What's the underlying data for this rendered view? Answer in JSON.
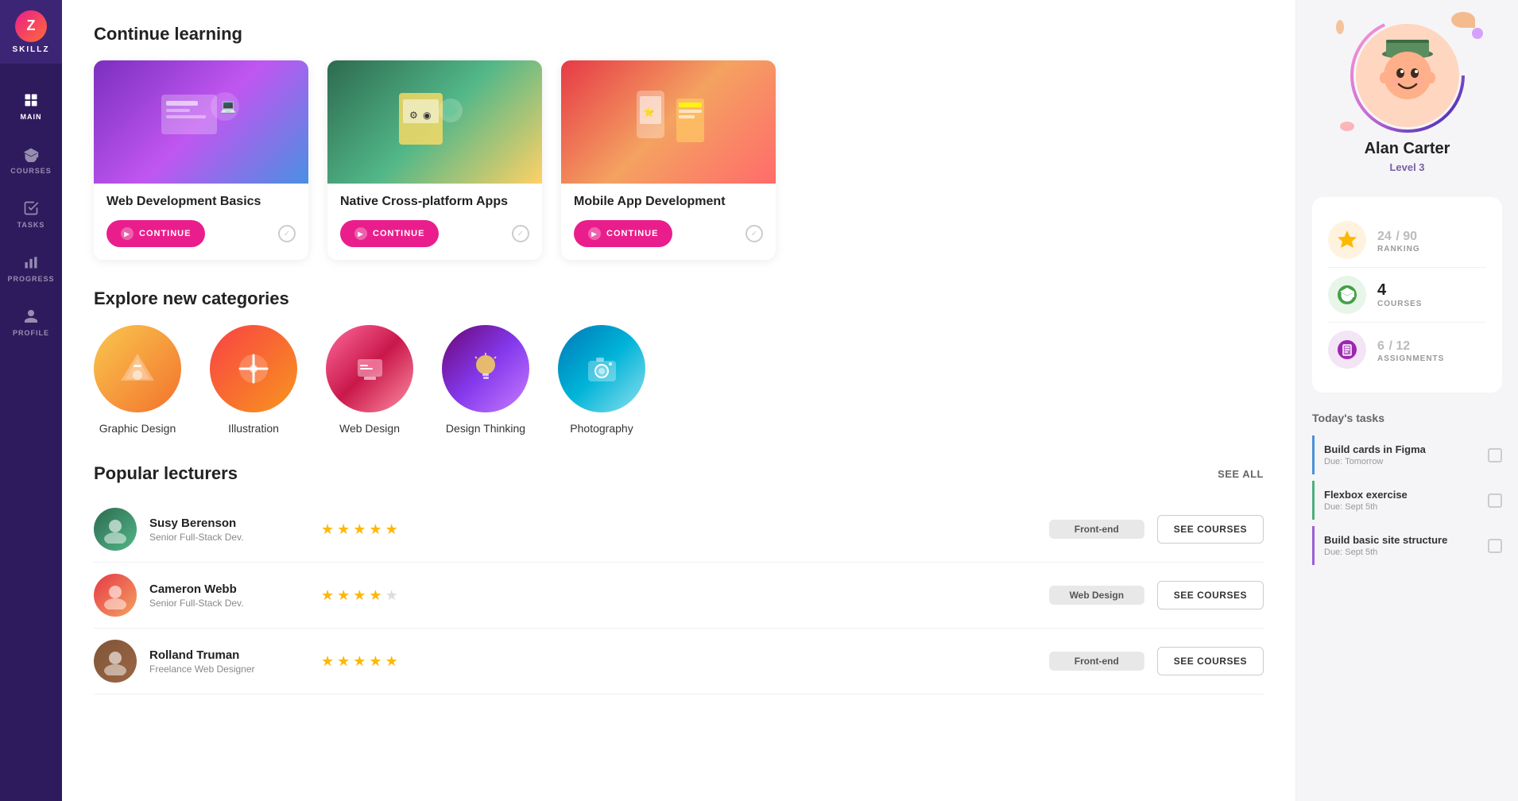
{
  "app": {
    "name": "SKILLZ",
    "logo_letter": "Z"
  },
  "sidebar": {
    "items": [
      {
        "id": "main",
        "label": "MAIN",
        "icon": "grid"
      },
      {
        "id": "courses",
        "label": "COURSES",
        "icon": "graduation"
      },
      {
        "id": "tasks",
        "label": "TASKS",
        "icon": "check-square"
      },
      {
        "id": "progress",
        "label": "PROGRESS",
        "icon": "bar-chart"
      },
      {
        "id": "profile",
        "label": "PROFILE",
        "icon": "person"
      }
    ],
    "active": "main"
  },
  "continue_learning": {
    "title": "Continue learning",
    "courses": [
      {
        "id": "web-dev",
        "title": "Web Development Basics",
        "button_label": "CONTINUE"
      },
      {
        "id": "native-apps",
        "title": "Native Cross-platform Apps",
        "button_label": "CONTINUE"
      },
      {
        "id": "mobile-dev",
        "title": "Mobile App Development",
        "button_label": "CONTINUE"
      }
    ]
  },
  "explore": {
    "title": "Explore new categories",
    "categories": [
      {
        "id": "graphic-design",
        "label": "Graphic Design",
        "emoji": "🎨"
      },
      {
        "id": "illustration",
        "label": "Illustration",
        "emoji": "✏️"
      },
      {
        "id": "web-design",
        "label": "Web Design",
        "emoji": "🖥️"
      },
      {
        "id": "design-thinking",
        "label": "Design Thinking",
        "emoji": "💡"
      },
      {
        "id": "photography",
        "label": "Photography",
        "emoji": "📷"
      }
    ]
  },
  "lecturers": {
    "title": "Popular lecturers",
    "see_all_label": "SEE ALL",
    "items": [
      {
        "id": "susy",
        "name": "Susy Berenson",
        "role": "Senior Full-Stack Dev.",
        "rating": 5,
        "tag": "Front-end",
        "button_label": "SEE COURSES",
        "avatar_emoji": "👩"
      },
      {
        "id": "cameron",
        "name": "Cameron Webb",
        "role": "Senior Full-Stack Dev.",
        "rating": 4,
        "tag": "Web Design",
        "button_label": "SEE COURSES",
        "avatar_emoji": "👨"
      },
      {
        "id": "rolland",
        "name": "Rolland Truman",
        "role": "Freelance Web Designer",
        "rating": 5,
        "tag": "Front-end",
        "button_label": "SEE COURSES",
        "avatar_emoji": "🧔"
      }
    ]
  },
  "profile": {
    "name": "Alan Carter",
    "level": "Level 3",
    "avatar_emoji": "🧒",
    "stats": {
      "ranking_current": "24",
      "ranking_total": "90",
      "ranking_label": "RANKING",
      "courses_count": "4",
      "courses_label": "COURSES",
      "assignments_current": "6",
      "assignments_total": "12",
      "assignments_label": "ASSIGNMENTS"
    }
  },
  "tasks": {
    "title": "Today's tasks",
    "items": [
      {
        "id": "task1",
        "name": "Build cards in Figma",
        "due": "Due: Tomorrow",
        "color": "blue"
      },
      {
        "id": "task2",
        "name": "Flexbox exercise",
        "due": "Due: Sept 5th",
        "color": "green"
      },
      {
        "id": "task3",
        "name": "Build basic site structure",
        "due": "Due: Sept 5th",
        "color": "purple"
      }
    ]
  }
}
